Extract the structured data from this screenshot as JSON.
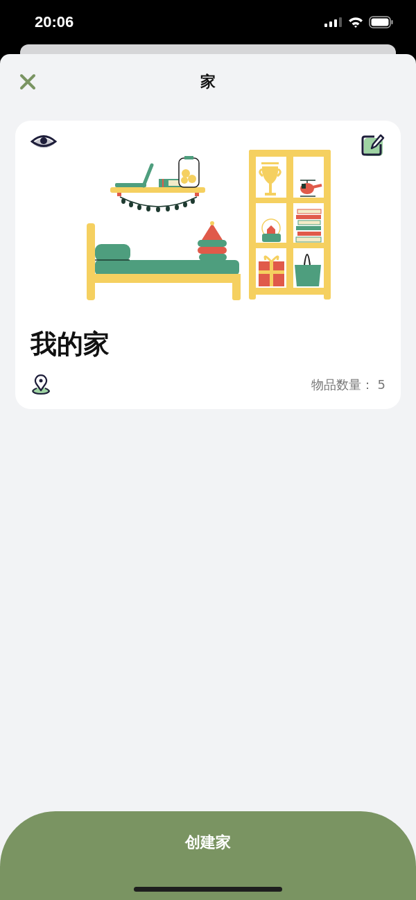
{
  "status_bar": {
    "time": "20:06"
  },
  "header": {
    "title": "家"
  },
  "home_card": {
    "title": "我的家",
    "item_count": "物品数量： 5"
  },
  "create_button": {
    "label": "创建家"
  }
}
